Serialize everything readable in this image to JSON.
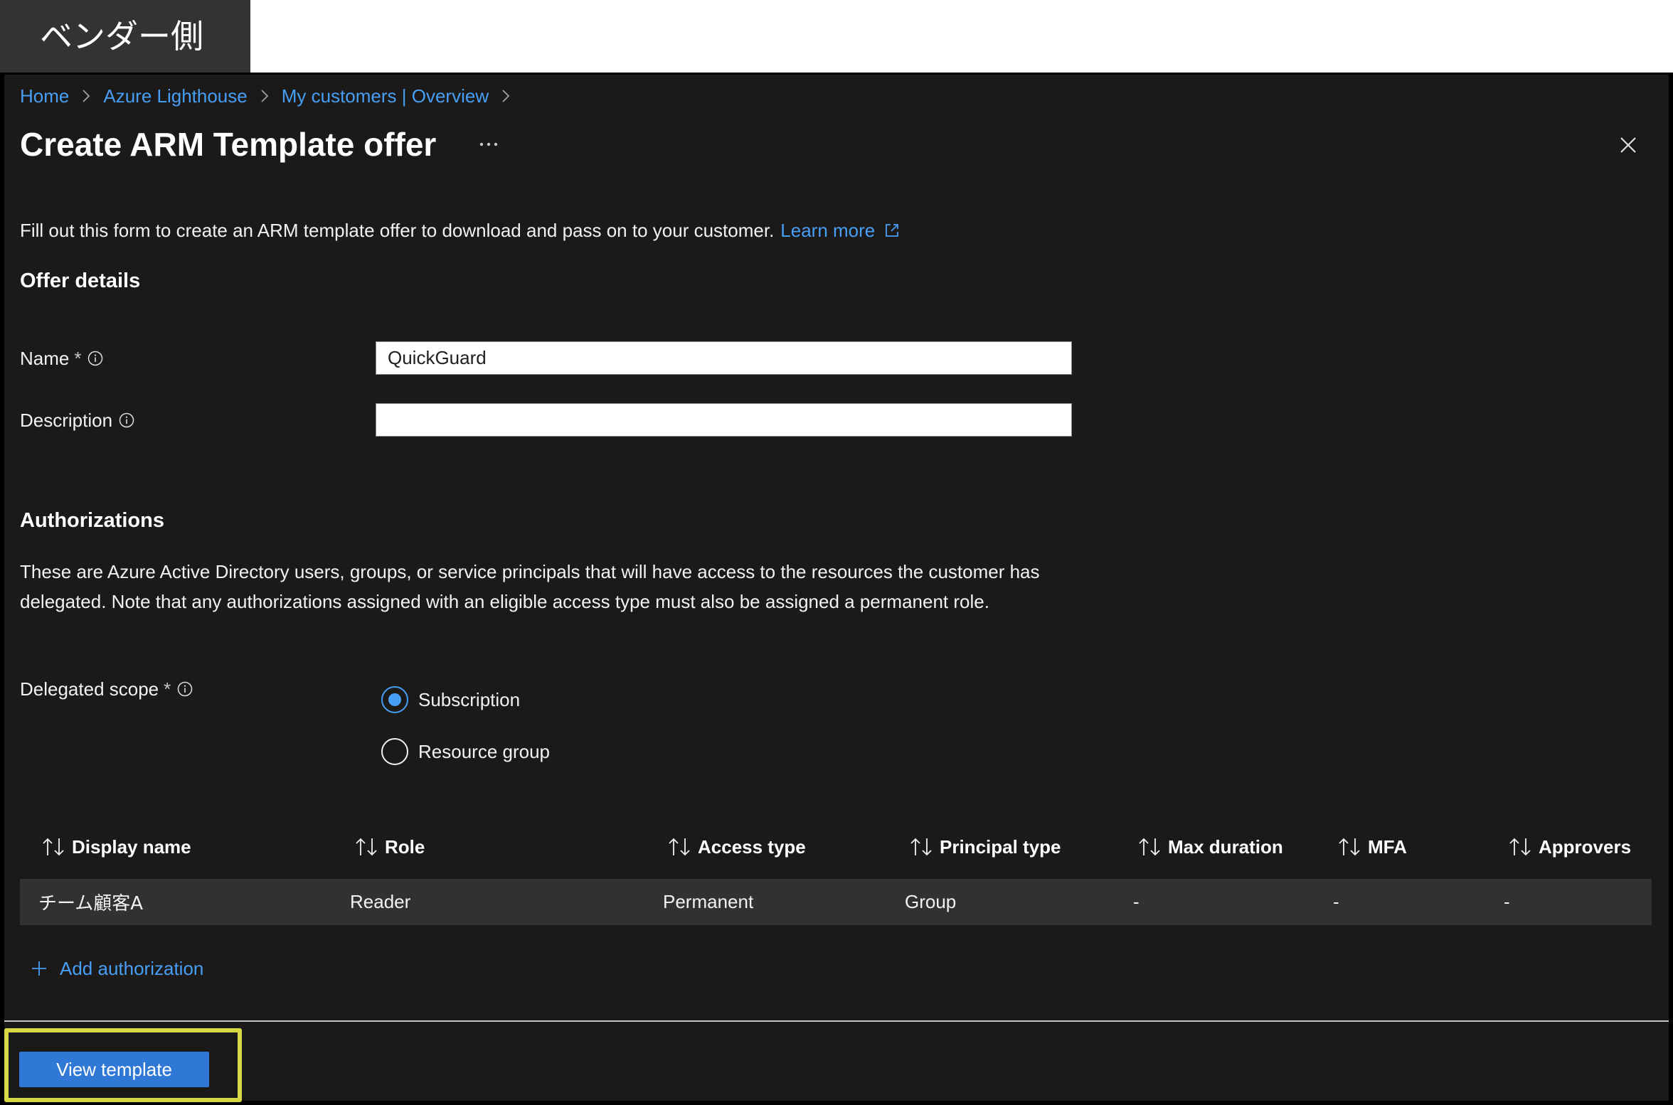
{
  "annotation": {
    "label": "ベンダー側"
  },
  "breadcrumb": {
    "items": [
      "Home",
      "Azure Lighthouse",
      "My customers | Overview"
    ]
  },
  "header": {
    "title": "Create ARM Template offer"
  },
  "intro": {
    "text": "Fill out this form to create an ARM template offer to download and pass on to your customer.",
    "learn_more": "Learn more"
  },
  "offer_details": {
    "heading": "Offer details",
    "name": {
      "label": "Name",
      "required_mark": "*",
      "value": "QuickGuard"
    },
    "description": {
      "label": "Description",
      "value": ""
    }
  },
  "authorizations": {
    "heading": "Authorizations",
    "text": "These are Azure Active Directory users, groups, or service principals that will have access to the resources the customer has delegated. Note that any authorizations assigned with an eligible access type must also be assigned a permanent role.",
    "delegated_scope": {
      "label": "Delegated scope",
      "required_mark": "*",
      "options": [
        {
          "label": "Subscription",
          "selected": true
        },
        {
          "label": "Resource group",
          "selected": false
        }
      ]
    },
    "table": {
      "columns": [
        "Display name",
        "Role",
        "Access type",
        "Principal type",
        "Max duration",
        "MFA",
        "Approvers"
      ],
      "rows": [
        [
          "チーム顧客A",
          "Reader",
          "Permanent",
          "Group",
          "-",
          "-",
          "-"
        ]
      ]
    },
    "add_label": "Add authorization"
  },
  "footer": {
    "view_template_label": "View template"
  },
  "icons": {
    "breadcrumb_separator": "chevron-right-icon",
    "more": "more-icon",
    "close": "close-icon",
    "external_link": "external-link-icon",
    "info": "info-icon",
    "sort": "sort-icon",
    "add": "plus-icon"
  },
  "colors": {
    "link": "#479ef5",
    "primary_button": "#2f78d6",
    "panel_background": "#1b1a19",
    "row_background": "#323130",
    "highlight": "#eded4a"
  }
}
